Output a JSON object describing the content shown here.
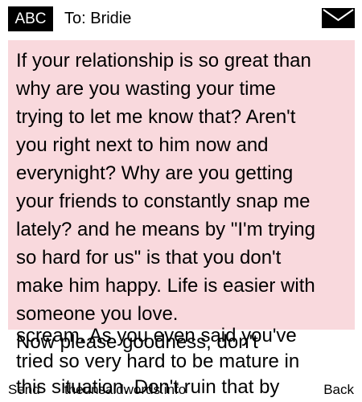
{
  "header": {
    "mode_badge": "ABC",
    "to_line": "To: Bridie",
    "envelope_icon": "envelope-icon"
  },
  "message": {
    "body": "If your relationship is so great than\nwhy are you wasting your time\ntrying to let me know that? Aren't\nyou right next to him now and\neverynight? Why are you getting\nyour friends to constantly snap me\nlately? and he means by \"I'm trying\nso hard for us\" is that you don't\nmake him happy. Life is easier with\nsomeone you love.\nNow please goodness, don't",
    "continuation": "scream. As you even said you've\ntried so very hard to be mature in\nthis situation. Don't ruin that by"
  },
  "footer": {
    "left_softkey": "Send",
    "center_text": "theunsaidwords.info",
    "right_softkey": "Back"
  },
  "colors": {
    "message_background": "#f9d9dd",
    "badge_background": "#000000"
  }
}
